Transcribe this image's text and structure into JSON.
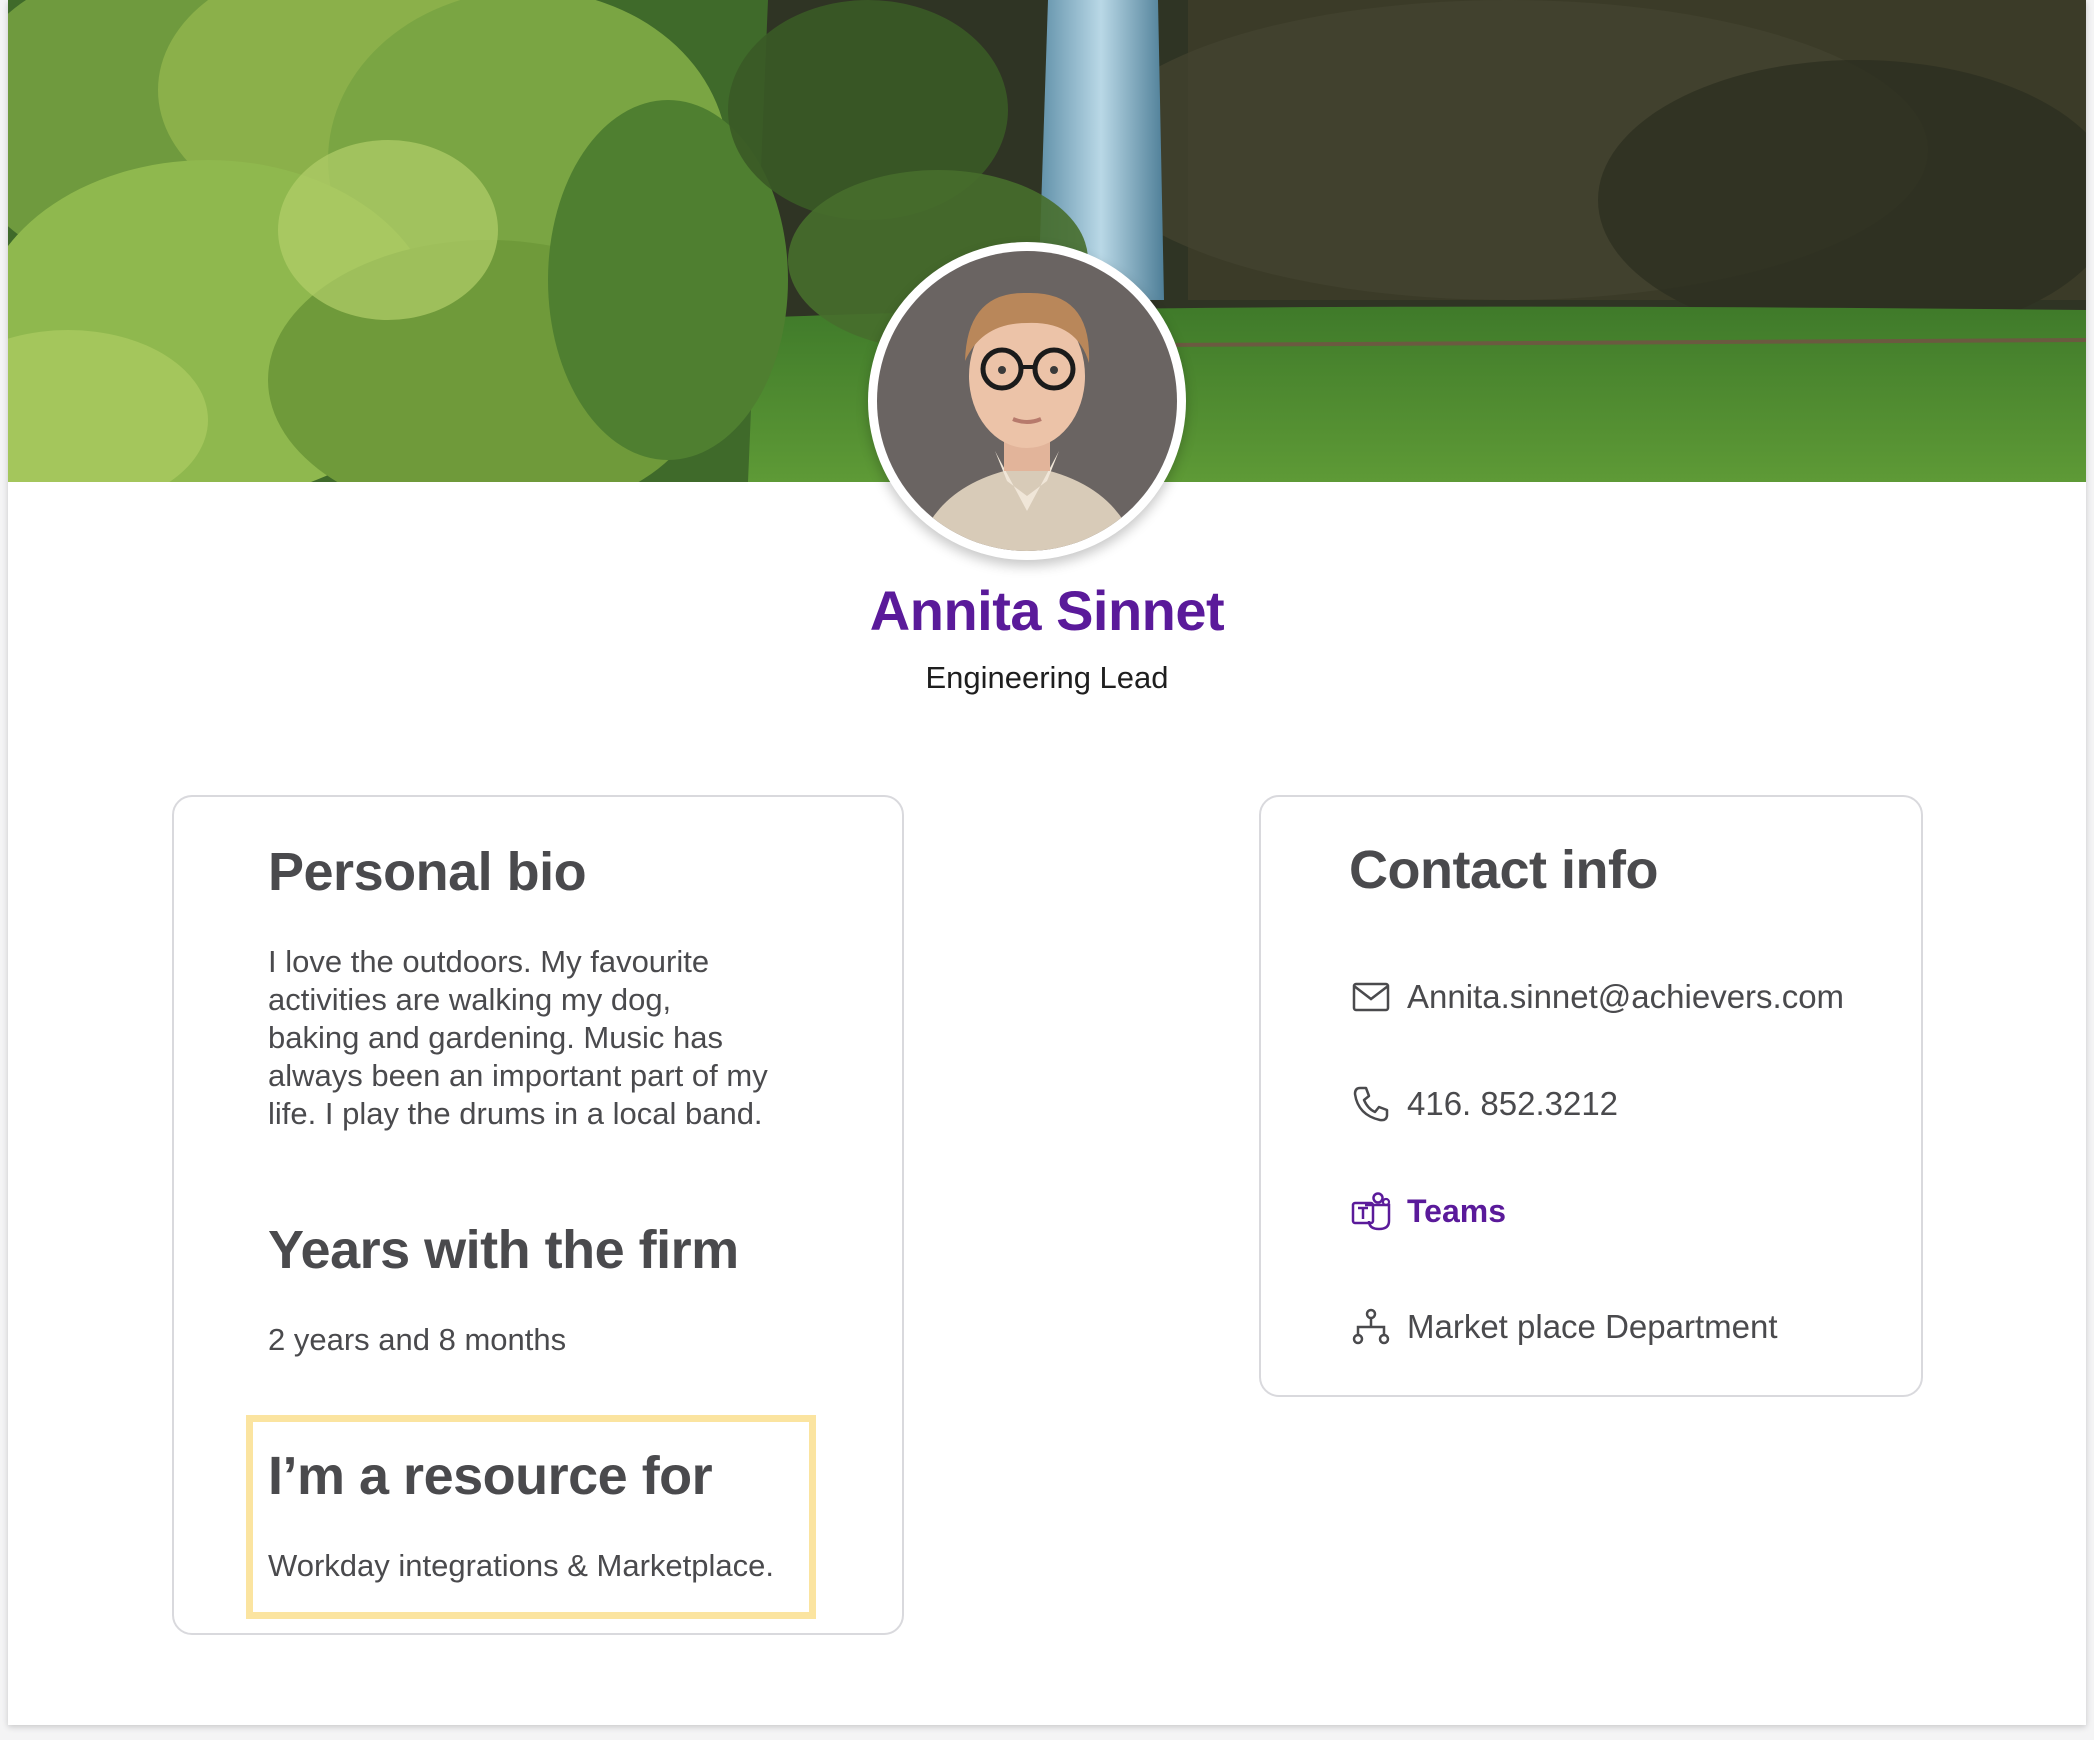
{
  "profile": {
    "name": "Annita Sinnet",
    "title": "Engineering Lead"
  },
  "bio_card": {
    "bio_heading": "Personal bio",
    "bio_lines": [
      "I love the outdoors. My favourite",
      "activities are walking my dog,",
      "baking and gardening. Music has",
      "always been an important part of my",
      "life. I play the drums in a local band."
    ],
    "years_heading": "Years with the firm",
    "years_value": "2 years and 8 months",
    "resource_heading": "I’m a resource for",
    "resource_value": "Workday integrations & Marketplace."
  },
  "contact_card": {
    "heading": "Contact info",
    "email": {
      "icon": "envelope-icon",
      "value": "Annita.sinnet@achievers.com"
    },
    "phone": {
      "icon": "phone-icon",
      "value": "416. 852.3212"
    },
    "teams": {
      "icon": "teams-icon",
      "value": "Teams"
    },
    "department": {
      "icon": "org-chart-icon",
      "value": "Market place Department"
    }
  },
  "colors": {
    "brand_purple": "#5a1a9a",
    "text_gray": "#4a4a4d",
    "highlight_yellow": "#fbe4a0",
    "card_border": "#d9d9dd"
  }
}
